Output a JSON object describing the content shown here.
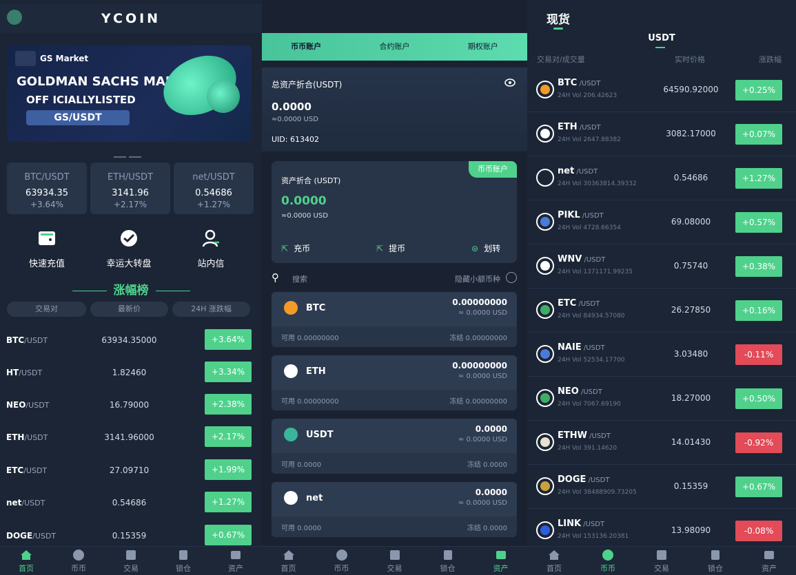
{
  "home": {
    "title": "YCOIN",
    "banner": {
      "brand": "GS Market",
      "line1": "GOLDMAN SACHS MARKETS",
      "line2": "OFF ICIALLYLISTED",
      "pair": "GS/USDT"
    },
    "tickers": [
      {
        "pair": "BTC/USDT",
        "price": "63934.35",
        "change": "+3.64%"
      },
      {
        "pair": "ETH/USDT",
        "price": "3141.96",
        "change": "+2.17%"
      },
      {
        "pair": "net/USDT",
        "price": "0.54686",
        "change": "+1.27%"
      }
    ],
    "quick_actions": [
      {
        "label": "快速充值",
        "icon": "wallet-icon"
      },
      {
        "label": "幸运大转盘",
        "icon": "wheel-icon"
      },
      {
        "label": "站内信",
        "icon": "user-message-icon"
      }
    ],
    "rank_title": "涨幅榜",
    "table_headers": [
      "交易对",
      "最新价",
      "24H 涨跌幅"
    ],
    "rows": [
      {
        "base": "BTC",
        "quote": "/USDT",
        "price": "63934.35000",
        "change": "+3.64%"
      },
      {
        "base": "HT",
        "quote": "/USDT",
        "price": "1.82460",
        "change": "+3.34%"
      },
      {
        "base": "NEO",
        "quote": "/USDT",
        "price": "16.79000",
        "change": "+2.38%"
      },
      {
        "base": "ETH",
        "quote": "/USDT",
        "price": "3141.96000",
        "change": "+2.17%"
      },
      {
        "base": "ETC",
        "quote": "/USDT",
        "price": "27.09710",
        "change": "+1.99%"
      },
      {
        "base": "net",
        "quote": "/USDT",
        "price": "0.54686",
        "change": "+1.27%"
      },
      {
        "base": "DOGE",
        "quote": "/USDT",
        "price": "0.15359",
        "change": "+0.67%"
      }
    ]
  },
  "assets": {
    "tabs": [
      "币币账户",
      "合约账户",
      "期权账户"
    ],
    "total_label": "总资产折合(USDT)",
    "total_value": "0.0000",
    "total_usd": "≈0.0000 USD",
    "uid": "UID: 613402",
    "card": {
      "tag": "币币账户",
      "label": "资产折合 (USDT)",
      "value": "0.0000",
      "usd": "≈0.0000 USD",
      "actions": [
        "充币",
        "提币",
        "划转"
      ]
    },
    "search_placeholder": "搜索",
    "hide_small": "隐藏小额币种",
    "coins": [
      {
        "name": "BTC",
        "amount": "0.00000000",
        "usd": "≈ 0.0000 USD",
        "available": "可用 0.00000000",
        "frozen": "冻结 0.00000000",
        "color": "#f39a28"
      },
      {
        "name": "ETH",
        "amount": "0.00000000",
        "usd": "≈ 0.0000 USD",
        "available": "可用 0.00000000",
        "frozen": "冻结 0.00000000",
        "color": "#ffffff"
      },
      {
        "name": "USDT",
        "amount": "0.0000",
        "usd": "≈ 0.0000 USD",
        "available": "可用 0.0000",
        "frozen": "冻结 0.0000",
        "color": "#3bb59a"
      },
      {
        "name": "net",
        "amount": "0.0000",
        "usd": "≈ 0.0000 USD",
        "available": "可用 0.0000",
        "frozen": "冻结 0.0000",
        "color": "#ffffff"
      }
    ]
  },
  "spot": {
    "title": "现货",
    "tab": "USDT",
    "headers": [
      "交易对/成交量",
      "实时价格",
      "涨跌幅"
    ],
    "rows": [
      {
        "base": "BTC",
        "quote": " /USDT",
        "vol": "24H Vol 206.42623",
        "price": "64590.92000",
        "change": "+0.25%",
        "up": true,
        "color": "#f39a28"
      },
      {
        "base": "ETH",
        "quote": " /USDT",
        "vol": "24H Vol 2647.88382",
        "price": "3082.17000",
        "change": "+0.07%",
        "up": true,
        "color": "#ffffff"
      },
      {
        "base": "net",
        "quote": " /USDT",
        "vol": "24H Vol 30363814.39332",
        "price": "0.54686",
        "change": "+1.27%",
        "up": true,
        "color": "#1b2535"
      },
      {
        "base": "PIKL",
        "quote": " /USDT",
        "vol": "24H Vol 4728.66354",
        "price": "69.08000",
        "change": "+0.57%",
        "up": true,
        "color": "#4a7bd8"
      },
      {
        "base": "WNV",
        "quote": " /USDT",
        "vol": "24H Vol 1371171.99235",
        "price": "0.75740",
        "change": "+0.38%",
        "up": true,
        "color": "#ffffff"
      },
      {
        "base": "ETC",
        "quote": " /USDT",
        "vol": "24H Vol 84934.57080",
        "price": "26.27850",
        "change": "+0.16%",
        "up": true,
        "color": "#3fae64"
      },
      {
        "base": "NAIE",
        "quote": " /USDT",
        "vol": "24H Vol 52534.17700",
        "price": "3.03480",
        "change": "-0.11%",
        "up": false,
        "color": "#4a7bd8"
      },
      {
        "base": "NEO",
        "quote": " /USDT",
        "vol": "24H Vol 7067.69190",
        "price": "18.27000",
        "change": "+0.50%",
        "up": true,
        "color": "#3fae64"
      },
      {
        "base": "ETHW",
        "quote": " /USDT",
        "vol": "24H Vol 391.14620",
        "price": "14.01430",
        "change": "-0.92%",
        "up": false,
        "color": "#e8e0d0"
      },
      {
        "base": "DOGE",
        "quote": " /USDT",
        "vol": "24H Vol 38488909.73205",
        "price": "0.15359",
        "change": "+0.67%",
        "up": true,
        "color": "#c9a23b"
      },
      {
        "base": "LINK",
        "quote": " /USDT",
        "vol": "24H Vol 153136.20381",
        "price": "13.98090",
        "change": "-0.08%",
        "up": false,
        "color": "#2d5ee0"
      }
    ]
  },
  "nav": {
    "labels": [
      "首页",
      "币币",
      "交易",
      "锁仓",
      "资产"
    ]
  }
}
